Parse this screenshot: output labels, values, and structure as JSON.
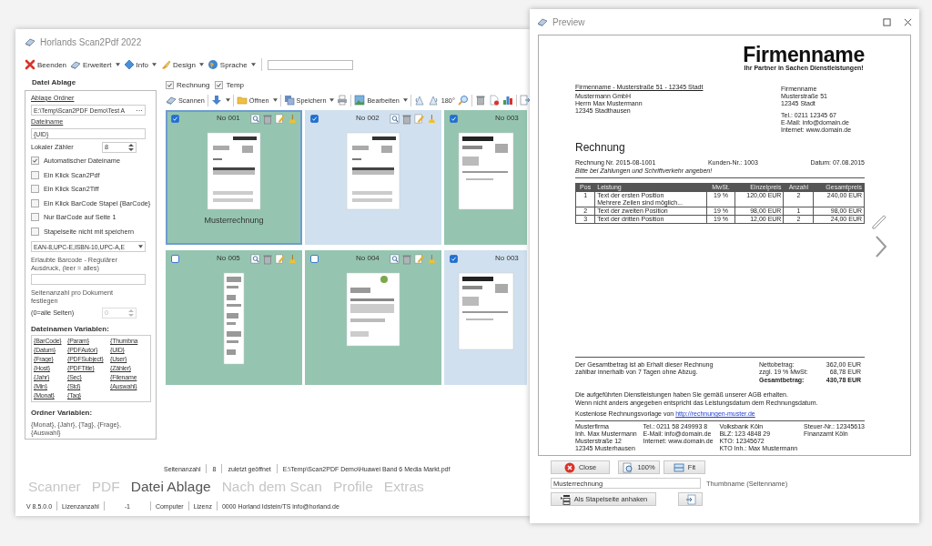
{
  "main_window": {
    "title": "Horlands Scan2Pdf 2022",
    "menu": [
      {
        "label": "Beenden",
        "dropdown": false
      },
      {
        "label": "Erweitert",
        "dropdown": true
      },
      {
        "label": "Info",
        "dropdown": true
      },
      {
        "label": "Design",
        "dropdown": true
      },
      {
        "label": "Sprache",
        "dropdown": true
      }
    ],
    "sidebar": {
      "heading": "Datei Ablage",
      "items": [
        {
          "kind": "link-label",
          "text": "Ablage Ordner"
        },
        {
          "kind": "path-field",
          "value": "E:\\Temp\\Scan2PDF Demo\\Test A",
          "button": "···"
        },
        {
          "kind": "link-label",
          "text": "Dateiname"
        },
        {
          "kind": "field",
          "value": "{UID}"
        },
        {
          "kind": "spin",
          "label": "Lokaler Zähler",
          "value": "8",
          "disabled": false
        },
        {
          "kind": "checkbox",
          "label": "Automatischer Dateiname",
          "checked": true
        },
        {
          "kind": "checkbox",
          "label": "Ein Klick Scan2Pdf",
          "checked": false
        },
        {
          "kind": "checkbox",
          "label": "Ein Klick Scan2Tiff",
          "checked": false
        },
        {
          "kind": "checkbox",
          "label": "Ein Klick BarCode Stapel {BarCode}",
          "checked": false
        },
        {
          "kind": "checkbox",
          "label": "Nur BarCode auf Seite 1",
          "checked": false
        },
        {
          "kind": "checkbox",
          "label": "Stapelseite nicht mit speichern",
          "checked": false
        },
        {
          "kind": "dropdown",
          "value": "EAN-8,UPC-E,ISBN-10,UPC-A,E"
        },
        {
          "kind": "text",
          "text": "Erlaubte Barcode - Regulärer Ausdruck, (leer = alles)"
        },
        {
          "kind": "field"
        },
        {
          "kind": "text",
          "text": "Seitenanzahl pro Dokument festlegen"
        },
        {
          "kind": "spin",
          "label": "(0=alle Seiten)",
          "value": "0",
          "disabled": true
        },
        {
          "kind": "heading",
          "text": "Dateinamen Variablen:"
        },
        {
          "kind": "variables",
          "items": [
            "{BarCode}",
            "{Param}",
            "{Thumbna",
            "{Datum}",
            "{PDFAutor}",
            "{UID}",
            "{Frage}",
            "{PDFSubject}",
            "{User}",
            "{Host}",
            "{PDFTitle}",
            "{Zähler}",
            "{Jahr}",
            "{Sec}",
            "{Filename",
            "{Min}",
            "{Std}",
            "{Auswahl}",
            "{Monat}",
            "{Tag}"
          ]
        },
        {
          "kind": "heading",
          "text": "Ordner Variablen:"
        },
        {
          "kind": "text",
          "text": "{Monat}, {Jahr}, {Tag}, {Frage}, {Auswahl}"
        }
      ]
    },
    "filters": [
      {
        "label": "Rechnung",
        "checked": true
      },
      {
        "label": "Temp",
        "checked": true
      }
    ],
    "toolbar": [
      {
        "kind": "button",
        "label": "Scannen",
        "dropdown": false
      },
      {
        "kind": "separator"
      },
      {
        "kind": "icon",
        "dropdown": true
      },
      {
        "kind": "separator"
      },
      {
        "kind": "button",
        "label": "Öffnen",
        "dropdown": true
      },
      {
        "kind": "separator"
      },
      {
        "kind": "button",
        "label": "Speichern",
        "dropdown": true
      },
      {
        "kind": "icon",
        "dropdown": false
      },
      {
        "kind": "separator"
      },
      {
        "kind": "button",
        "label": "Bearbeiten",
        "dropdown": true
      },
      {
        "kind": "separator"
      },
      {
        "kind": "icon",
        "dropdown": false
      },
      {
        "kind": "icon",
        "dropdown": false
      },
      {
        "kind": "text",
        "label": "180°"
      },
      {
        "kind": "icon",
        "dropdown": false
      },
      {
        "kind": "separator"
      },
      {
        "kind": "icon",
        "dropdown": false
      },
      {
        "kind": "icon",
        "dropdown": false
      },
      {
        "kind": "icon",
        "dropdown": false
      },
      {
        "kind": "separator"
      },
      {
        "kind": "icon",
        "dropdown": false
      }
    ],
    "thumbnails": [
      {
        "label": "No 001",
        "checked": true,
        "selected": true,
        "color": "#95c5b0",
        "tools": true,
        "caption": "Musterrechnung"
      },
      {
        "label": "No 002",
        "checked": true,
        "selected": false,
        "color": "#d0e0ef",
        "tools": true
      },
      {
        "label": "No 003",
        "checked": true,
        "selected": false,
        "color": "#95c5b0",
        "tools": false
      },
      {
        "label": "No 005",
        "checked": false,
        "selected": false,
        "color": "#95c5b0",
        "tools": true
      },
      {
        "label": "No 004",
        "checked": false,
        "selected": false,
        "color": "#95c5b0",
        "tools": true
      },
      {
        "label": "No 003",
        "checked": true,
        "selected": false,
        "color": "#d0e0ef",
        "tools": false
      }
    ],
    "status": [
      "Seitenanzahl",
      "8",
      "zuletzt geöffnet",
      "E:\\Temp\\Scan2PDF Demo\\Huawei Band 6 Media Markt.pdf"
    ],
    "tabs": [
      {
        "label": "Scanner",
        "selected": false
      },
      {
        "label": "PDF",
        "selected": false
      },
      {
        "label": "Datei Ablage",
        "selected": true
      },
      {
        "label": "Nach dem Scan",
        "selected": false
      },
      {
        "label": "Profile",
        "selected": false
      },
      {
        "label": "Extras",
        "selected": false
      }
    ],
    "footer": [
      "V 8.5.0.0",
      "Lizenzanzahl",
      "-1",
      "Computer",
      "Lizenz",
      "0000 Horland Idstein/TS info@horland.de"
    ]
  },
  "preview": {
    "title": "Preview",
    "document": {
      "company": "Firmenname",
      "tagline": "Ihr Partner in Sachen Dienstleistungen!",
      "sender_line": "Firmenname - Musterstraße 51 - 12345 Stadt",
      "recipient": [
        "Mustermann GmbH",
        "Herrn Max Mustermann",
        "12345 Stadthausen"
      ],
      "company_address": [
        "Firmenname",
        "Musterstraße 51",
        "12345 Stadt"
      ],
      "company_contact": [
        "Tel.: 0211 12345 67",
        "E-Mail: info@domain.de",
        "Internet: www.domain.de"
      ],
      "heading": "Rechnung",
      "meta": [
        "Rechnung Nr. 2015-08-1001",
        "Kunden-Nr.: 1003",
        "Datum: 07.08.2015"
      ],
      "note": "Bitte bei Zahlungen und Schriftverkehr angeben!",
      "table": {
        "columns": [
          "Pos",
          "Leistung",
          "MwSt.",
          "Einzelpreis",
          "Anzahl",
          "Gesamtpreis"
        ],
        "rows": [
          [
            "1",
            "Text der ersten Position\nMehrere Zeilen sind möglich...",
            "19 %",
            "120,00 EUR",
            "2",
            "240,00 EUR"
          ],
          [
            "2",
            "Text der zweiten Position",
            "19 %",
            "98,00 EUR",
            "1",
            "98,00 EUR"
          ],
          [
            "3",
            "Text der dritten Position",
            "19 %",
            "12,00 EUR",
            "2",
            "24,00 EUR"
          ]
        ]
      },
      "payment_terms": "Der Gesamtbetrag ist ab Erhalt dieser Rechnung zahlbar innerhalb von 7 Tagen ohne Abzug.",
      "totals": [
        {
          "label": "Nettobetrag:",
          "value": "362,00 EUR",
          "bold": false
        },
        {
          "label": "zzgl. 19 % MwSt:",
          "value": "68,78 EUR",
          "bold": false
        },
        {
          "label": "Gesamtbetrag:",
          "value": "430,78 EUR",
          "bold": true
        }
      ],
      "remarks": [
        "Die aufgeführten Dienstleistungen haben Sie gemäß unserer AGB erhalten.",
        "Wenn nicht anders angegeben entspricht das Leistungsdatum dem Rechnungsdatum."
      ],
      "template_note": {
        "text": "Kostenlose Rechnungsvorlage von",
        "link": "http://rechnungen-muster.de"
      },
      "footer_columns": [
        [
          "Musterfirma",
          "Inh. Max Mustermann",
          "Musterstraße 12",
          "12345 Musterhausen"
        ],
        [
          "Tel.: 0211 58 249993 8",
          "E-Mail: info@domain.de",
          "Internet: www.domain.de"
        ],
        [
          "Volksbank Köln",
          "BLZ: 123 4848 29",
          "KTO: 12345672",
          "KTO Inh.: Max Mustermann"
        ],
        [
          "Steuer-Nr.: 12345613",
          "Finanzamt Köln"
        ]
      ]
    },
    "buttons": [
      {
        "label": "Close"
      },
      {
        "label": "100%"
      },
      {
        "label": "Fit"
      }
    ],
    "thumbname": {
      "value": "Musterrechnung",
      "label": "Thumbname (Seitenname)"
    },
    "stack_button": "Als Stapelseite anhaken"
  }
}
